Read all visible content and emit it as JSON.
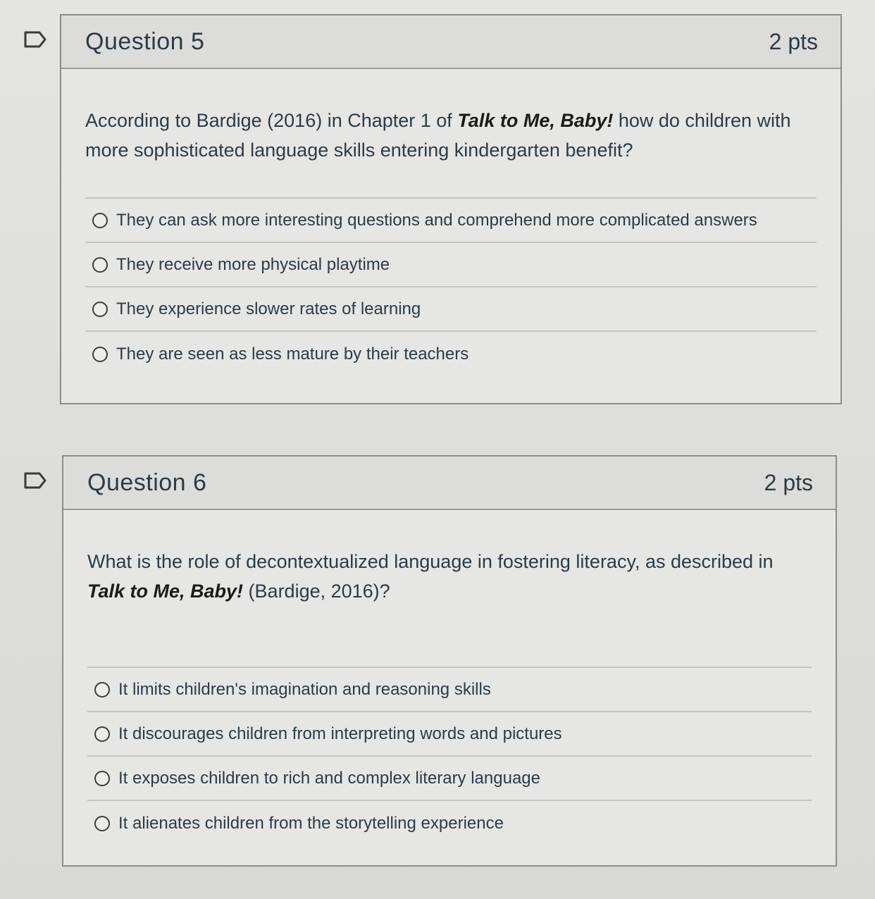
{
  "questions": [
    {
      "title": "Question 5",
      "points": "2 pts",
      "text_before": "According to Bardige (2016) in Chapter 1 of ",
      "text_bold": "Talk to Me, Baby!",
      "text_after": " how do children with more sophisticated language skills entering kindergarten benefit?",
      "answers": [
        "They can ask more interesting questions and comprehend more complicated answers",
        "They receive more physical playtime",
        "They experience slower rates of learning",
        "They are seen as less mature by their teachers"
      ]
    },
    {
      "title": "Question 6",
      "points": "2 pts",
      "text_before": "What is the role of decontextualized language in fostering literacy, as described in ",
      "text_bold": "Talk to Me, Baby!",
      "text_after": " (Bardige, 2016)?",
      "answers": [
        "It limits children's imagination and reasoning skills",
        "It discourages children from interpreting words and pictures",
        "It exposes children to rich and complex literary language",
        "It alienates children from the storytelling experience"
      ]
    }
  ]
}
